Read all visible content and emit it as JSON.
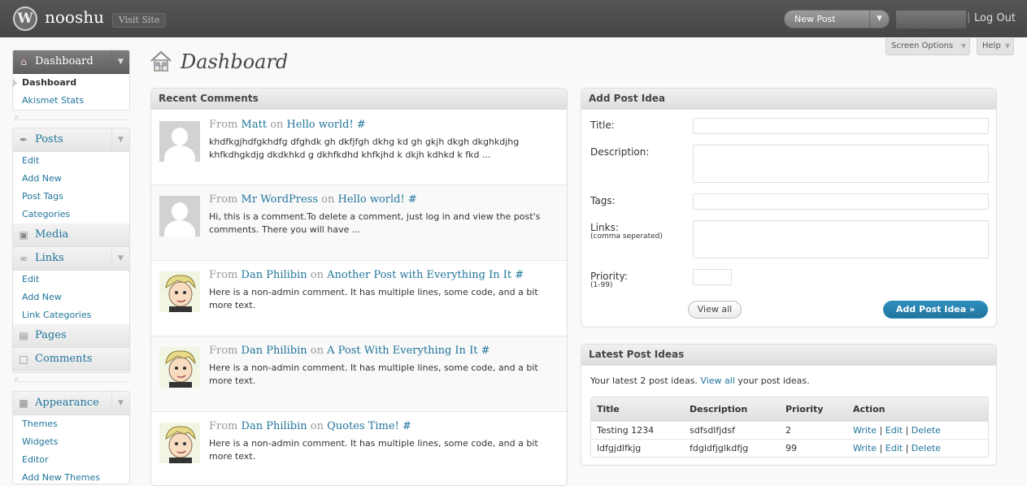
{
  "header": {
    "logo": "W",
    "site_title": "nooshu",
    "visit_site": "Visit Site",
    "new_post": "New Post",
    "logout": "Log Out",
    "logout_separator": "|"
  },
  "screen_options": "Screen Options",
  "help": "Help",
  "page": {
    "title": "Dashboard"
  },
  "menu": {
    "dashboard": {
      "label": "Dashboard",
      "items": [
        "Dashboard",
        "Akismet Stats"
      ]
    },
    "posts": {
      "label": "Posts",
      "items": [
        "Edit",
        "Add New",
        "Post Tags",
        "Categories"
      ]
    },
    "media": {
      "label": "Media"
    },
    "links": {
      "label": "Links",
      "items": [
        "Edit",
        "Add New",
        "Link Categories"
      ]
    },
    "pages": {
      "label": "Pages"
    },
    "comments": {
      "label": "Comments"
    },
    "appearance": {
      "label": "Appearance",
      "items": [
        "Themes",
        "Widgets",
        "Editor",
        "Add New Themes"
      ]
    }
  },
  "recent_comments": {
    "title": "Recent Comments",
    "items": [
      {
        "from": "From",
        "author": "Matt",
        "on": "on",
        "post": "Hello world!",
        "hash": "#",
        "text": "khdfkgjhdfgkhdfg dfghdk gh dkfjfgh dkhg kd gh gkjh dkgh dkghkdjhg khfkdhgkdjg dkdkhkd g dkhfkdhd khfkjhd k dkjh kdhkd k fkd ..."
      },
      {
        "from": "From",
        "author": "Mr WordPress",
        "on": "on",
        "post": "Hello world!",
        "hash": "#",
        "text": "Hi, this is a comment.To delete a comment, just log in and view the post's comments. There you will have ..."
      },
      {
        "from": "From",
        "author": "Dan Philibin",
        "on": "on",
        "post": "Another Post with Everything In It",
        "hash": "#",
        "text": "Here is a non-admin comment. It has multiple lines, some code, and a bit more text."
      },
      {
        "from": "From",
        "author": "Dan Philibin",
        "on": "on",
        "post": "A Post With Everything In It",
        "hash": "#",
        "text": "Here is a non-admin comment. It has multiple lines, some code, and a bit more text."
      },
      {
        "from": "From",
        "author": "Dan Philibin",
        "on": "on",
        "post": "Quotes Time!",
        "hash": "#",
        "text": "Here is a non-admin comment. It has multiple lines, some code, and a bit more text."
      }
    ]
  },
  "add_post_idea": {
    "title": "Add Post Idea",
    "fields": {
      "title": "Title:",
      "description": "Description:",
      "tags": "Tags:",
      "links": "Links:",
      "links_hint": "(comma seperated)",
      "priority": "Priority:",
      "priority_hint": "(1-99)"
    },
    "view_all": "View all",
    "submit": "Add Post Idea »"
  },
  "latest_post_ideas": {
    "title": "Latest Post Ideas",
    "intro_before": "Your latest 2 post ideas.",
    "intro_link": "View all",
    "intro_after": "your post ideas.",
    "columns": [
      "Title",
      "Description",
      "Priority",
      "Action"
    ],
    "rows": [
      {
        "title": "Testing 1234",
        "description": "sdfsdlfjdsf",
        "priority": "2"
      },
      {
        "title": "ldfgjdlfkjg",
        "description": "fdgldfjglkdfjg",
        "priority": "99"
      }
    ],
    "actions": [
      "Write",
      "Edit",
      "Delete"
    ],
    "action_separator": "|"
  }
}
